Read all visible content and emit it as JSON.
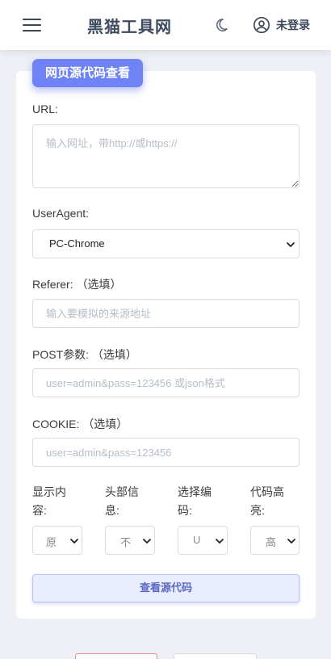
{
  "header": {
    "site_title": "黑猫工具网",
    "login_label": "未登录"
  },
  "card": {
    "tag": "网页源代码查看"
  },
  "form": {
    "url": {
      "label": "URL:",
      "placeholder": "输入网址，带http://或https://"
    },
    "useragent": {
      "label": "UserAgent:",
      "value": "PC-Chrome"
    },
    "referer": {
      "label": "Referer: （选填）",
      "placeholder": "输入要模拟的来源地址"
    },
    "post": {
      "label": "POST参数: （选填）",
      "placeholder": "user=admin&pass=123456 或json格式"
    },
    "cookie": {
      "label": "COOKIE: （选填）",
      "placeholder": "user=admin&pass=123456"
    },
    "options": [
      {
        "label_l1": "显示内",
        "label_l2": "容:",
        "value": "原"
      },
      {
        "label_l1": "头部信",
        "label_l2": "息:",
        "value": "不"
      },
      {
        "label_l1": "选择编",
        "label_l2": "码:",
        "value": "U"
      },
      {
        "label_l1": "代码高",
        "label_l2": "亮:",
        "value": "高"
      }
    ],
    "submit_label": "查看源代码"
  },
  "colors": {
    "accent": "#6f83f5",
    "submit_bg": "#eaedfd",
    "page_bg": "#eef0f6"
  }
}
